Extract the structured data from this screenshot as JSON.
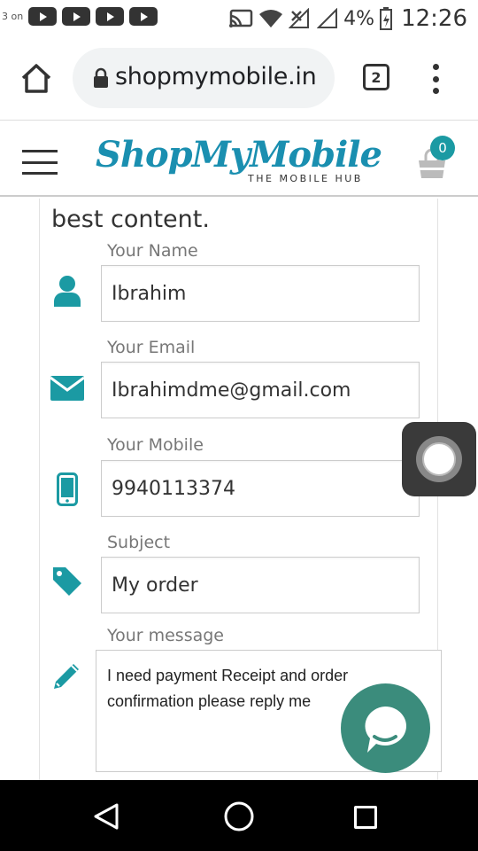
{
  "status_bar": {
    "left_label": "3 on",
    "battery": "4%",
    "time": "12:26"
  },
  "browser": {
    "url": "shopmymobile.in",
    "tab_count": "2"
  },
  "site": {
    "logo_main": "ShopMyMobile",
    "logo_sub": "THE MOBILE HUB",
    "cart_count": "0"
  },
  "form": {
    "intro_text": "best content.",
    "fields": [
      {
        "label": "Your Name",
        "value": "Ibrahim",
        "icon": "user-icon"
      },
      {
        "label": "Your Email",
        "value": "Ibrahimdme@gmail.com",
        "icon": "envelope-icon"
      },
      {
        "label": "Your Mobile",
        "value": "9940113374",
        "icon": "mobile-phone-icon"
      },
      {
        "label": "Subject",
        "value": "My order",
        "icon": "tag-icon"
      }
    ],
    "message_label": "Your message",
    "message_value": "I need payment Receipt and order confirmation please reply me",
    "message_icon": "pencil-icon"
  },
  "colors": {
    "accent": "#1b9aa3",
    "chat_bubble": "#3b8c7c",
    "logo_text": "#1a8fb0"
  }
}
